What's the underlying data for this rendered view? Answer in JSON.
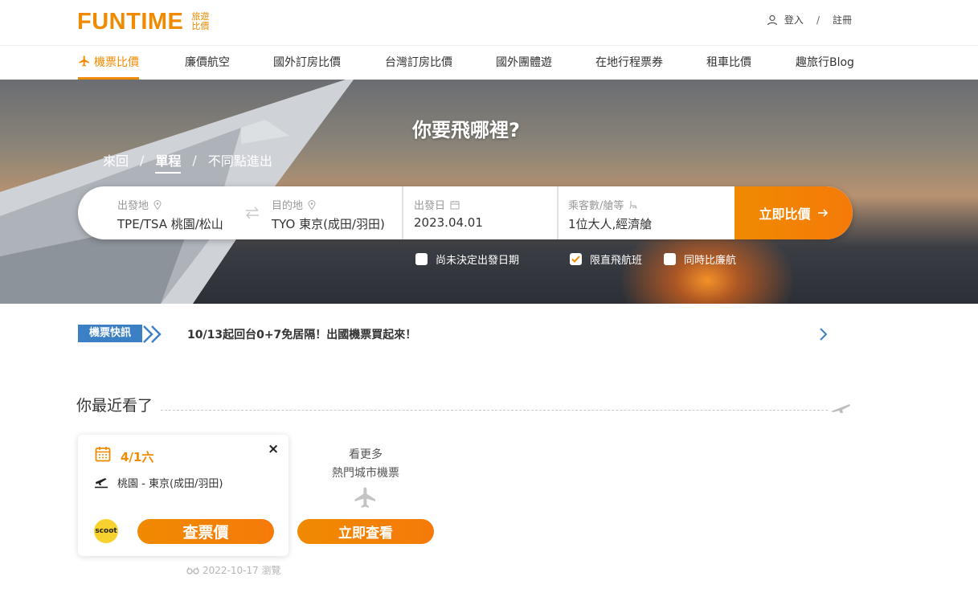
{
  "header": {
    "logo": "FUNTIME",
    "logo_sub_1": "旅遊",
    "logo_sub_2": "比價",
    "login": "登入",
    "separator": "/",
    "register": "註冊"
  },
  "nav": {
    "items": [
      {
        "label": "機票比價",
        "active": true
      },
      {
        "label": "廉價航空"
      },
      {
        "label": "國外訂房比價"
      },
      {
        "label": "台灣訂房比價"
      },
      {
        "label": "國外團體遊"
      },
      {
        "label": "在地行程票券"
      },
      {
        "label": "租車比價"
      },
      {
        "label": "趣旅行Blog"
      }
    ]
  },
  "hero": {
    "title": "你要飛哪裡?",
    "trip_types": [
      "來回",
      "單程",
      "不同點進出"
    ],
    "trip_separator": "/",
    "active_trip": "單程"
  },
  "search": {
    "origin_label": "出發地",
    "origin_value": "TPE/TSA 桃園/松山",
    "dest_label": "目的地",
    "dest_value": "TYO 東京(成田/羽田)",
    "date_label": "出發日",
    "date_value": "2023.04.01",
    "pax_label": "乘客數/艙等",
    "pax_value": "1位大人,經濟艙",
    "submit": "立即比價"
  },
  "options": [
    {
      "label": "尚未決定出發日期",
      "checked": false
    },
    {
      "label": "限直飛航班",
      "checked": true
    },
    {
      "label": "同時比廉航",
      "checked": false
    }
  ],
  "news": {
    "tag": "機票快訊",
    "text": "10/13起回台0+7免居隔！出國機票買起來！"
  },
  "recent": {
    "title": "你最近看了",
    "card": {
      "date": "4/1六",
      "close": "×",
      "route": "桃園 - 東京(成田/羽田)",
      "airline": "scoot",
      "button": "查票價",
      "viewed": "2022-10-17 瀏覽"
    },
    "more": {
      "line1": "看更多",
      "line2": "熱門城市機票",
      "button": "立即查看"
    }
  },
  "colors": {
    "brand": "#f08a00",
    "news_tag": "#3b7fc4"
  }
}
